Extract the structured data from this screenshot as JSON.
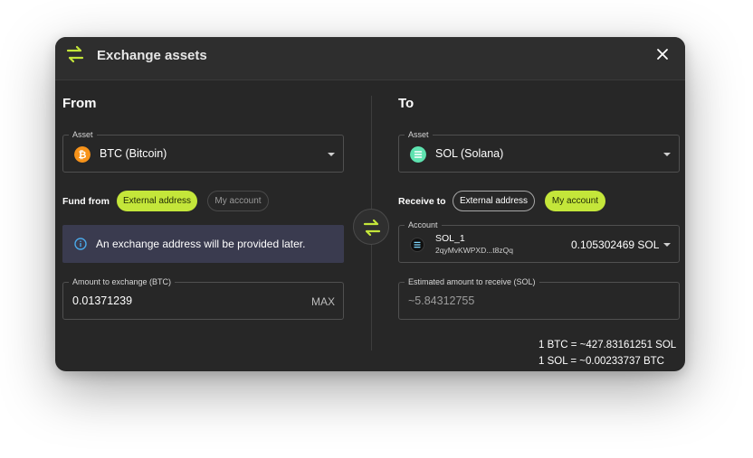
{
  "dialog": {
    "title": "Exchange assets",
    "accent_color": "#c4e63a",
    "icons": {
      "header": "swap-arrows-icon",
      "close": "close-icon"
    }
  },
  "from": {
    "title": "From",
    "asset_label": "Asset",
    "asset_value": "BTC (Bitcoin)",
    "asset_icon": "bitcoin-icon",
    "fund_from_label": "Fund from",
    "fund_options": [
      "External address",
      "My account"
    ],
    "fund_selected": "External address",
    "info_message": "An exchange address will be provided later.",
    "amount_label": "Amount to exchange (BTC)",
    "amount_value": "0.01371239",
    "max_label": "MAX"
  },
  "to": {
    "title": "To",
    "asset_label": "Asset",
    "asset_value": "SOL (Solana)",
    "asset_icon": "solana-icon",
    "receive_to_label": "Receive to",
    "receive_options": [
      "External address",
      "My account"
    ],
    "receive_selected": "My account",
    "account_label": "Account",
    "account_name": "SOL_1",
    "account_address": "2qyMvKWPXD...t8zQq",
    "account_balance": "0.105302469 SOL",
    "estimate_label": "Estimated amount to receive (SOL)",
    "estimate_value": "~5.84312755"
  },
  "rates": {
    "btc_to_sol": "1 BTC = ~427.83161251 SOL",
    "sol_to_btc": "1 SOL = ~0.00233737 BTC"
  }
}
